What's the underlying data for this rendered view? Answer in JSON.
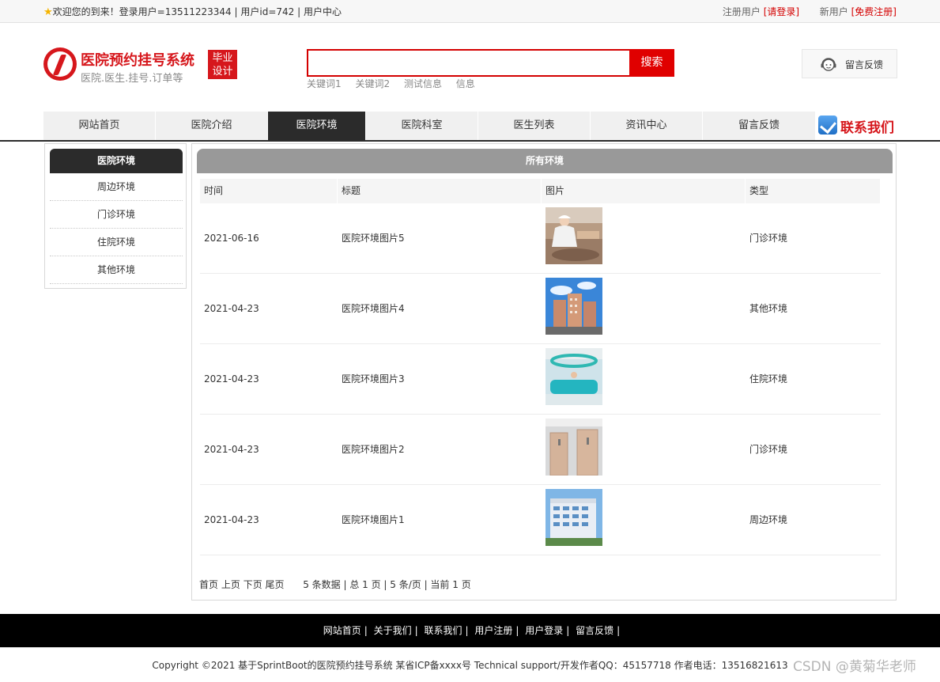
{
  "topbar": {
    "welcome": "欢迎您的到来！登录用户=13511223344 | 用户id=742 | 用户中心",
    "register_label": "注册用户",
    "login_link": "[请登录]",
    "new_user_label": "新用户",
    "free_register_link": "[免费注册]"
  },
  "logo": {
    "title": "医院预约挂号系统",
    "subtitle": "医院.医生.挂号.订单等",
    "badge_line1": "毕业",
    "badge_line2": "设计"
  },
  "search": {
    "value": "",
    "button_label": "搜索",
    "keywords": [
      "关键词1",
      "关键词2",
      "测试信息",
      "信息"
    ]
  },
  "feedback": {
    "label": "留言反馈"
  },
  "nav": {
    "items": [
      {
        "label": "网站首页"
      },
      {
        "label": "医院介绍"
      },
      {
        "label": "医院环境"
      },
      {
        "label": "医院科室"
      },
      {
        "label": "医生列表"
      },
      {
        "label": "资讯中心"
      },
      {
        "label": "留言反馈"
      }
    ],
    "active": "医院环境",
    "contact_label": "联系我们"
  },
  "sidebar": {
    "title": "医院环境",
    "items": [
      {
        "label": "周边环境"
      },
      {
        "label": "门诊环境"
      },
      {
        "label": "住院环境"
      },
      {
        "label": "其他环境"
      }
    ]
  },
  "main": {
    "title": "所有环境",
    "columns": [
      "时间",
      "标题",
      "图片",
      "类型"
    ],
    "rows": [
      {
        "date": "2021-06-16",
        "title": "医院环境图片5",
        "image": "nurse-photo",
        "type": "门诊环境"
      },
      {
        "date": "2021-04-23",
        "title": "医院环境图片4",
        "image": "building-sky-photo",
        "type": "其他环境"
      },
      {
        "date": "2021-04-23",
        "title": "医院环境图片3",
        "image": "reception-desk-photo",
        "type": "住院环境"
      },
      {
        "date": "2021-04-23",
        "title": "医院环境图片2",
        "image": "corridor-doors-photo",
        "type": "门诊环境"
      },
      {
        "date": "2021-04-23",
        "title": "医院环境图片1",
        "image": "hospital-building-photo",
        "type": "周边环境"
      }
    ],
    "pager": {
      "first": "首页",
      "prev": "上页",
      "next": "下页",
      "last": "尾页",
      "summary": "5 条数据 | 总 1 页 | 5 条/页 | 当前 1 页"
    }
  },
  "footer": {
    "links": [
      "网站首页",
      "关于我们",
      "联系我们",
      "用户注册",
      "用户登录",
      "留言反馈"
    ],
    "copyright": "Copyright ©2021 基于SprintBoot的医院预约挂号系统    某省ICP备xxxx号    Technical support/开发作者QQ：45157718    作者电话：13516821613",
    "watermark": "CSDN @黄菊华老师"
  },
  "colors": {
    "brand_red": "#d6171c",
    "nav_active": "#2b2b2b",
    "table_header": "#999999"
  }
}
